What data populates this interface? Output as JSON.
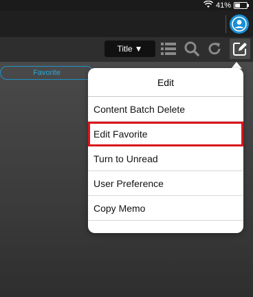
{
  "status_bar": {
    "battery_text": "41%",
    "battery_level": 0.41,
    "wifi_icon": "wifi-icon"
  },
  "toolbar": {
    "title_label": "Title",
    "title_dropdown_arrow": "▼",
    "icons": [
      "list-icon",
      "search-icon",
      "refresh-icon",
      "edit-icon"
    ]
  },
  "tabs": {
    "favorite_label": "Favorite"
  },
  "popover": {
    "title": "Edit",
    "items": [
      {
        "label": "Content Batch Delete"
      },
      {
        "label": "Edit Favorite"
      },
      {
        "label": "Turn to Unread"
      },
      {
        "label": "User Preference"
      },
      {
        "label": "Copy Memo"
      }
    ]
  },
  "colors": {
    "accent": "#1d93c9",
    "highlight": "#d9141a",
    "avatar": "#1a8fd6"
  }
}
